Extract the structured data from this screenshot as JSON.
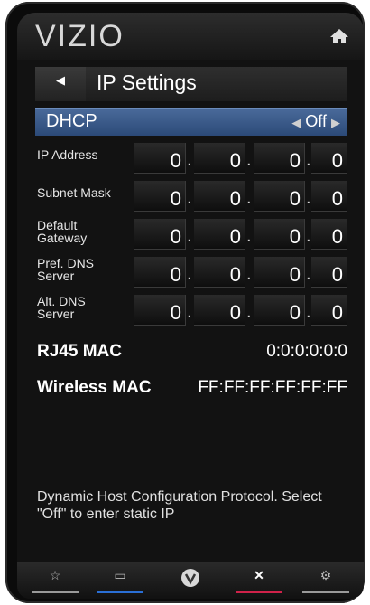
{
  "header": {
    "logo": "VIZIO",
    "home_icon": "home-icon"
  },
  "title": {
    "back_icon": "back-arrow-icon",
    "text": "IP Settings"
  },
  "dhcp": {
    "label": "DHCP",
    "value": "Off",
    "left_arrow": "◀",
    "right_arrow": "▶"
  },
  "ip_fields": [
    {
      "label": "IP Address",
      "octets": [
        "0",
        "0",
        "0",
        "0"
      ]
    },
    {
      "label": "Subnet Mask",
      "octets": [
        "0",
        "0",
        "0",
        "0"
      ]
    },
    {
      "label": "Default Gateway",
      "octets": [
        "0",
        "0",
        "0",
        "0"
      ]
    },
    {
      "label": "Pref. DNS Server",
      "octets": [
        "0",
        "0",
        "0",
        "0"
      ]
    },
    {
      "label": "Alt. DNS Server",
      "octets": [
        "0",
        "0",
        "0",
        "0"
      ]
    }
  ],
  "dot": ".",
  "mac": {
    "rj45_label": "RJ45 MAC",
    "rj45_value": "0:0:0:0:0:0",
    "wireless_label": "Wireless MAC",
    "wireless_value": "FF:FF:FF:FF:FF:FF"
  },
  "help_text": "Dynamic Host Configuration Protocol. Select \"Off\" to enter static IP",
  "bottom_bar": [
    {
      "name": "star-icon",
      "color": "#9a9a9a"
    },
    {
      "name": "input-icon",
      "color": "#2a6fd6"
    },
    {
      "name": "vizio-v-icon",
      "color": "#9a9a9a"
    },
    {
      "name": "close-x-icon",
      "color": "#d0224a"
    },
    {
      "name": "gear-icon",
      "color": "#9a9a9a"
    }
  ]
}
